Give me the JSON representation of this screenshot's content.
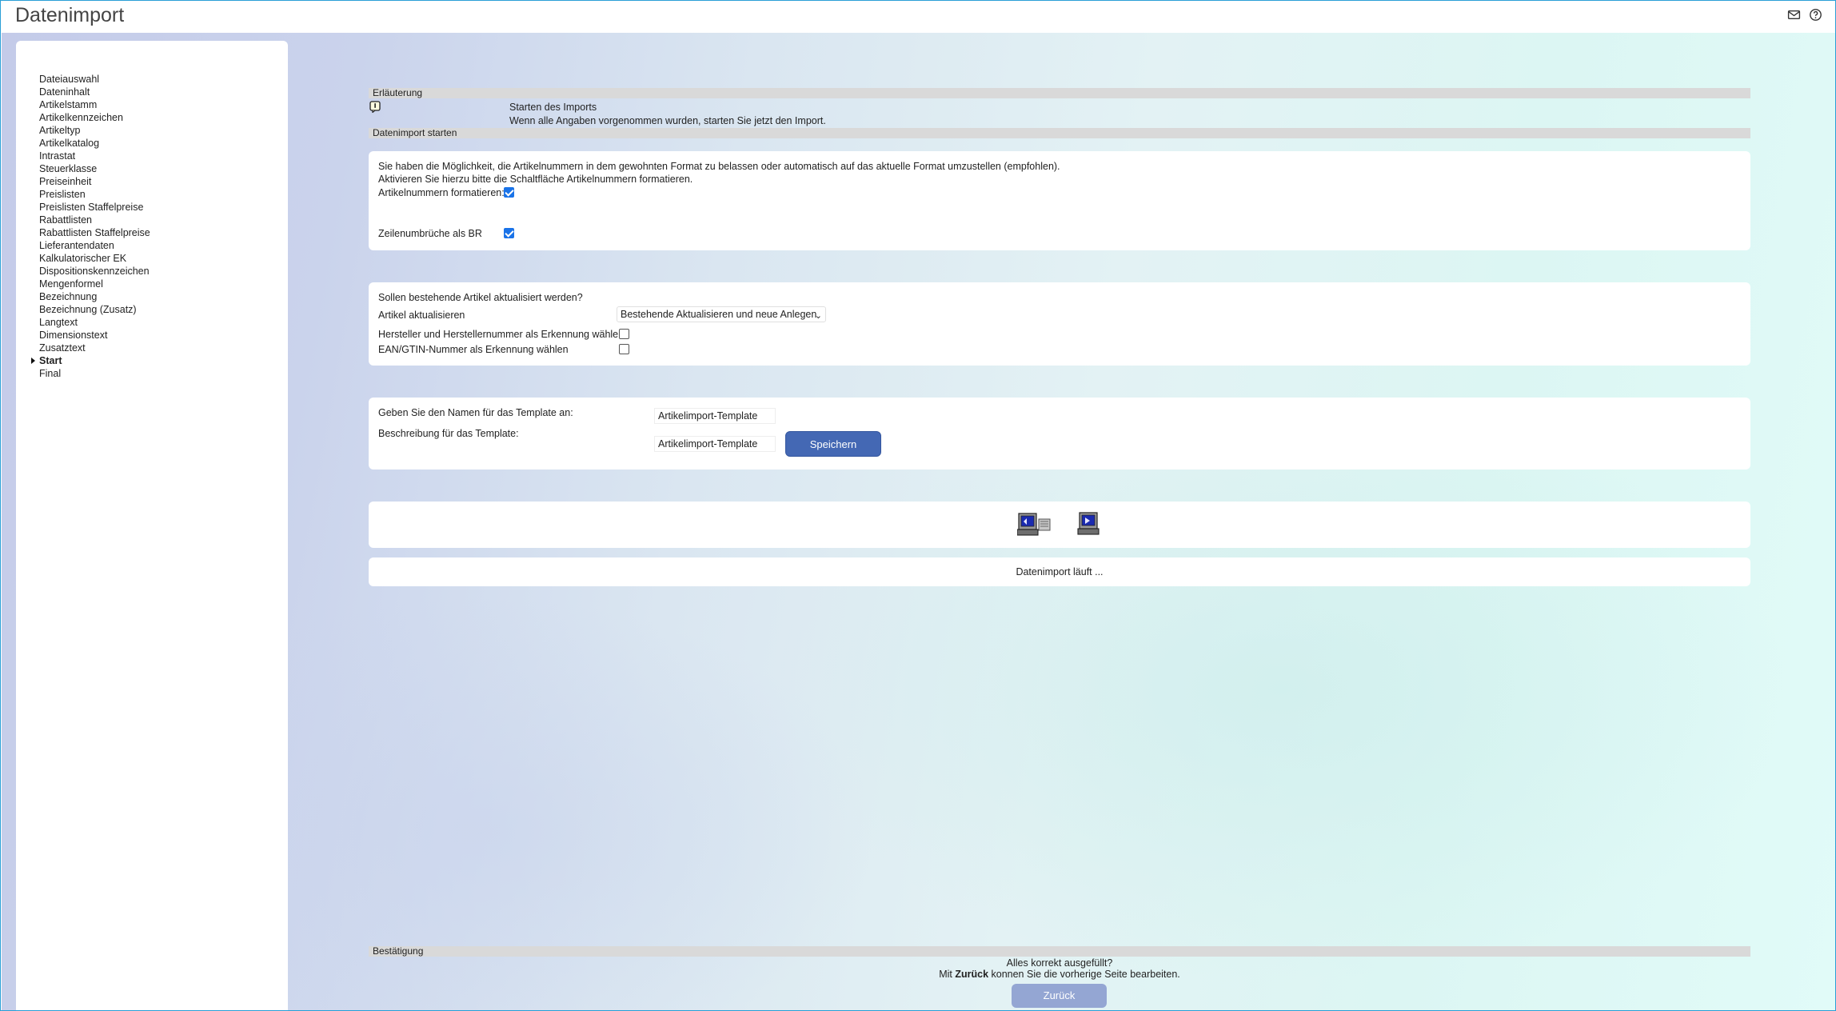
{
  "app": {
    "title": "Datenimport"
  },
  "header_icons": [
    "mail-icon",
    "help-icon"
  ],
  "sidebar": {
    "items": [
      {
        "label": "Dateiauswahl"
      },
      {
        "label": "Dateninhalt"
      },
      {
        "label": "Artikelstamm"
      },
      {
        "label": "Artikelkennzeichen"
      },
      {
        "label": "Artikeltyp"
      },
      {
        "label": "Artikelkatalog"
      },
      {
        "label": "Intrastat"
      },
      {
        "label": "Steuerklasse"
      },
      {
        "label": "Preiseinheit"
      },
      {
        "label": "Preislisten"
      },
      {
        "label": "Preislisten Staffelpreise"
      },
      {
        "label": "Rabattlisten"
      },
      {
        "label": "Rabattlisten Staffelpreise"
      },
      {
        "label": "Lieferantendaten"
      },
      {
        "label": "Kalkulatorischer EK"
      },
      {
        "label": "Dispositionskennzeichen"
      },
      {
        "label": "Mengenformel"
      },
      {
        "label": "Bezeichnung"
      },
      {
        "label": "Bezeichnung (Zusatz)"
      },
      {
        "label": "Langtext"
      },
      {
        "label": "Dimensionstext"
      },
      {
        "label": "Zusatztext"
      },
      {
        "label": "Start",
        "active": true
      },
      {
        "label": "Final"
      }
    ]
  },
  "explanation": {
    "heading": "Erläuterung",
    "title": "Starten des Imports",
    "text": "Wenn alle Angaben vorgenommen wurden, starten Sie jetzt den Import."
  },
  "start_section": {
    "heading": "Datenimport starten"
  },
  "format_card": {
    "line1": "Sie haben die Möglichkeit, die Artikelnummern in dem gewohnten Format zu belassen oder automatisch auf das aktuelle Format umzustellen (empfohlen).",
    "line2": "Aktivieren Sie hierzu bitte die Schaltfläche Artikelnummern formatieren.",
    "format_label": "Artikelnummern formatieren:",
    "format_checked": true,
    "linebreak_label": "Zeilenumbrüche als BR",
    "linebreak_checked": true
  },
  "update_card": {
    "question": "Sollen bestehende Artikel aktualisiert werden?",
    "update_label": "Artikel aktualisieren",
    "update_selected": "Bestehende Aktualisieren und neue Anlegen",
    "manufacturer_label": "Hersteller und Herstellernummer als Erkennung wählen",
    "manufacturer_checked": false,
    "ean_label": "EAN/GTIN-Nummer als Erkennung wählen",
    "ean_checked": false
  },
  "template_card": {
    "name_label": "Geben Sie den Namen für das Template an:",
    "name_value": "Artikelimport-Template",
    "desc_label": "Beschreibung für das Template:",
    "desc_value": "Artikelimport-Template",
    "save_label": "Speichern"
  },
  "progress": {
    "status": "Datenimport läuft ..."
  },
  "confirmation": {
    "heading": "Bestätigung",
    "question": "Alles korrekt ausgefüllt?",
    "hint_prefix": "Mit ",
    "hint_bold": "Zurück",
    "hint_suffix": " konnen Sie die vorherige Seite bearbeiten.",
    "back_label": "Zurück"
  },
  "colors": {
    "accent": "#4468b4",
    "back_button": "#94a6d3",
    "checkbox_checked": "#1a73e8",
    "section_header": "#d9d9d9"
  }
}
